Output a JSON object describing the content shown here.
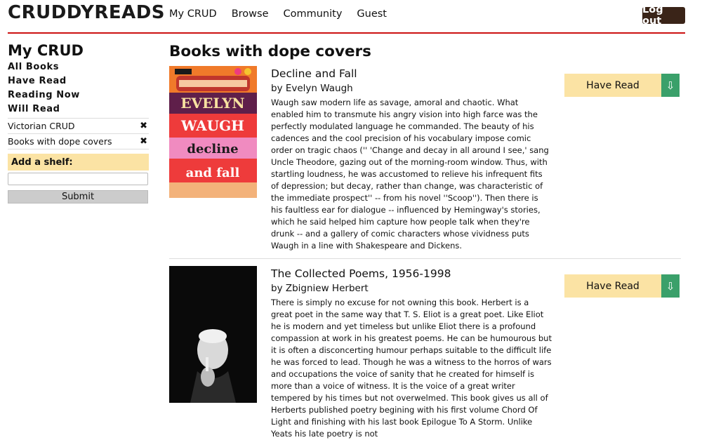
{
  "header": {
    "logo": "CRUDDYREADS",
    "nav": [
      "My CRUD",
      "Browse",
      "Community",
      "Guest"
    ],
    "logout": "Log out"
  },
  "sidebar": {
    "title": "My CRUD",
    "links": [
      "All Books",
      "Have Read",
      "Reading Now",
      "Will Read"
    ],
    "shelves": [
      "Victorian CRUD",
      "Books with dope covers"
    ],
    "add_shelf_label": "Add a shelf:",
    "submit_label": "Submit"
  },
  "main": {
    "title": "Books with dope covers",
    "books": [
      {
        "title": "Decline and Fall",
        "author": "by Evelyn Waugh",
        "description": "Waugh saw modern life as savage, amoral and chaotic. What enabled him to transmute his angry vision into high farce was the perfectly modulated language he commanded. The beauty of his cadences and the cool precision of his vocabulary impose comic order on tragic chaos ('' 'Change and decay in all around I see,' sang Uncle Theodore, gazing out of the morning-room window. Thus, with startling loudness, he was accustomed to relieve his infrequent fits of depression; but decay, rather than change, was characteristic of the immediate prospect'' -- from his novel ''Scoop''). Then there is his faultless ear for dialogue -- influenced by Hemingway's stories, which he said helped him capture how people talk when they're drunk -- and a gallery of comic characters whose vividness puts Waugh in a line with Shakespeare and Dickens.",
        "shelf_button": "Have Read",
        "cover_text": [
          "EVELYN",
          "WAUGH",
          "decline",
          "and fall"
        ]
      },
      {
        "title": "The Collected Poems, 1956-1998",
        "author": "by Zbigniew Herbert",
        "description": "There is simply no excuse for not owning this book. Herbert is a great poet in the same way that T. S. Eliot is a great poet. Like Eliot he is modern and yet timeless but unlike Eliot there is a profound compassion at work in his greatest poems. He can be humourous but it is often a disconcerting humour perhaps suitable to the difficult life he was forced to lead. Though he was a witness to the horros of wars and occupations the voice of sanity that he created for himself is more than a voice of witness. It is the voice of a great writer tempered by his times but not overwelmed. This book gives us all of Herberts published poetry begining with his first volume Chord Of Light and finishing with his last book Epilogue To A Storm. Unlike Yeats his late poetry is not",
        "shelf_button": "Have Read"
      }
    ]
  },
  "colors": {
    "accent_red": "#cc1111",
    "button_yellow": "#fbe3a4",
    "download_green": "#3aa06a",
    "logout_bg": "#3a2418"
  },
  "icons": {
    "remove": "close-icon",
    "download": "download-arrow-icon"
  }
}
